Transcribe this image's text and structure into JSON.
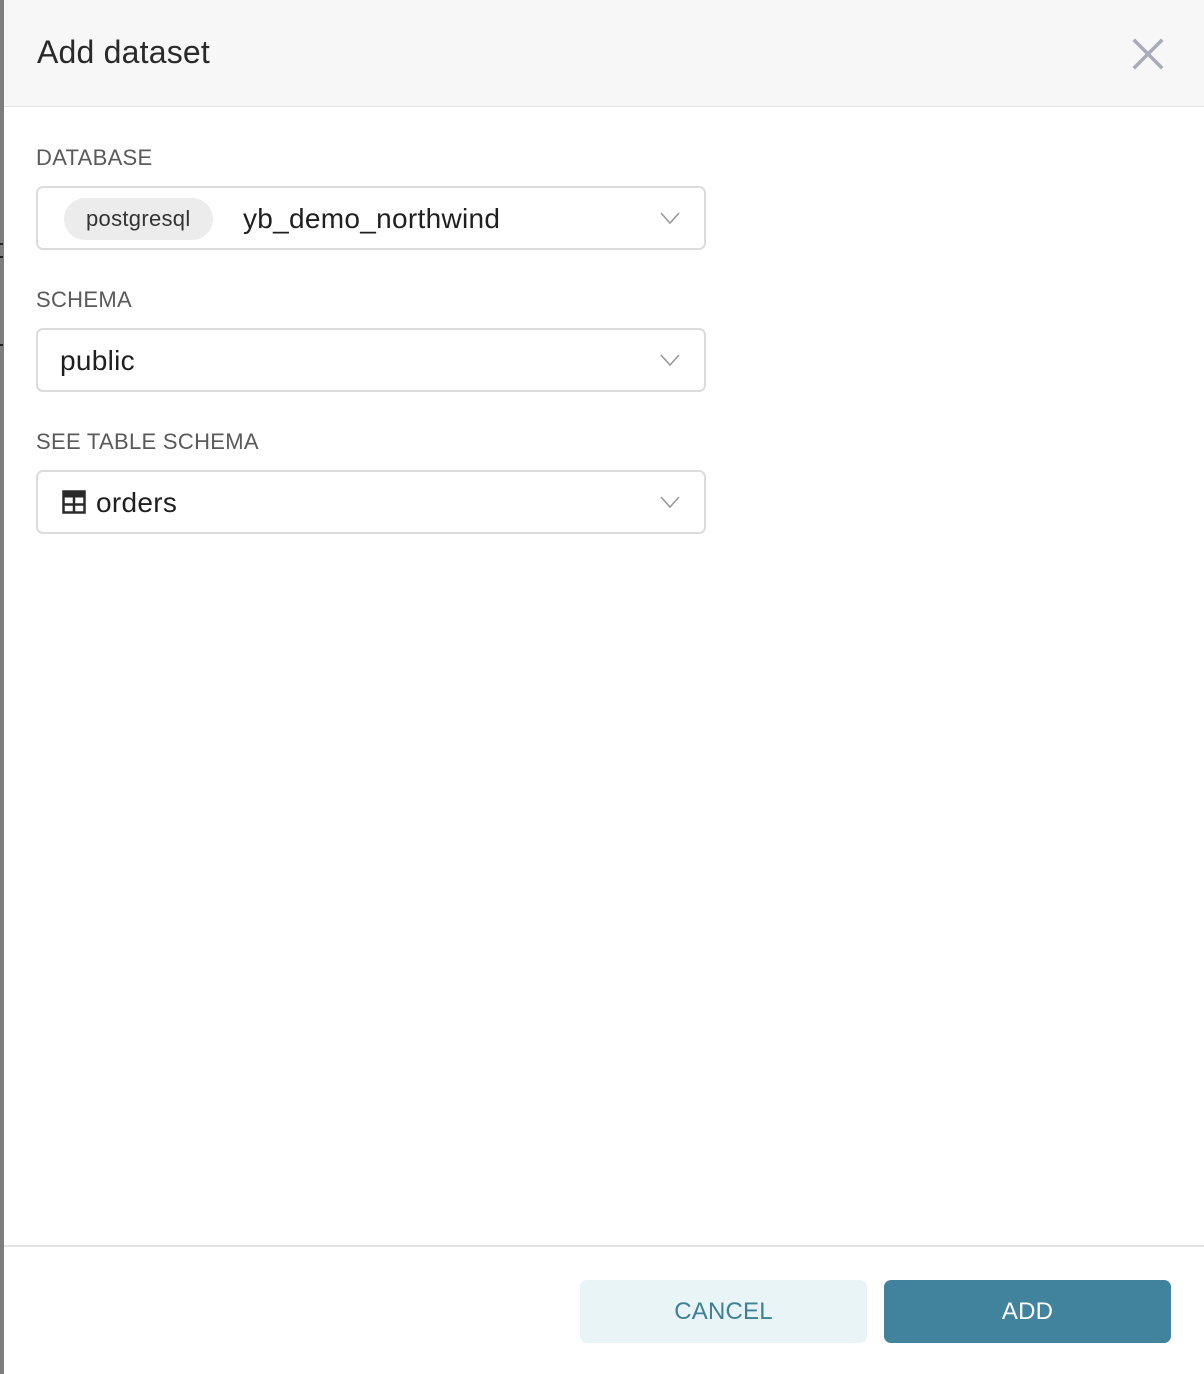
{
  "modal": {
    "title": "Add dataset",
    "close_icon": "close-icon"
  },
  "fields": {
    "database": {
      "label": "DATABASE",
      "backend_chip": "postgresql",
      "value": "yb_demo_northwind",
      "chevron_icon": "chevron-down-icon"
    },
    "schema": {
      "label": "SCHEMA",
      "value": "public",
      "chevron_icon": "chevron-down-icon"
    },
    "table": {
      "label": "SEE TABLE SCHEMA",
      "icon": "table-icon",
      "value": "orders",
      "chevron_icon": "chevron-down-icon"
    }
  },
  "footer": {
    "cancel_label": "CANCEL",
    "add_label": "ADD"
  },
  "colors": {
    "primary": "#41839c",
    "primary_light": "#e9f4f7",
    "header_bg": "#f7f7f7",
    "close_icon": "#a8abb8"
  }
}
